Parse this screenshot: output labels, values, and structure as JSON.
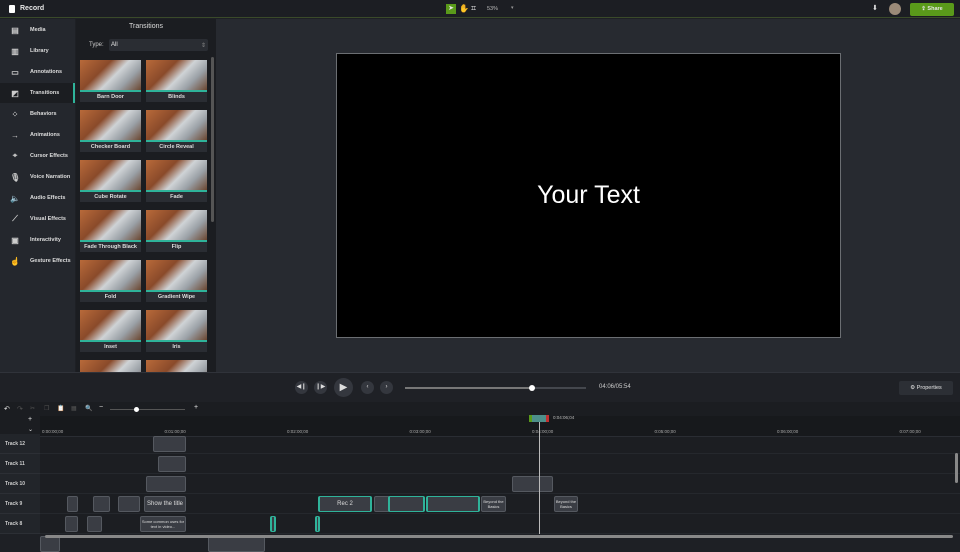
{
  "app": {
    "title": "Record",
    "zoom": "53%",
    "share_label": "Share",
    "accent": "#2fb39a",
    "share_color": "#5a9a1a"
  },
  "sidebar": {
    "items": [
      {
        "label": "Media",
        "icon": "film-icon"
      },
      {
        "label": "Library",
        "icon": "library-icon"
      },
      {
        "label": "Annotations",
        "icon": "annotation-icon"
      },
      {
        "label": "Transitions",
        "icon": "transition-icon",
        "active": true
      },
      {
        "label": "Behaviors",
        "icon": "behaviors-icon"
      },
      {
        "label": "Animations",
        "icon": "animation-icon"
      },
      {
        "label": "Cursor Effects",
        "icon": "cursor-icon"
      },
      {
        "label": "Voice Narration",
        "icon": "microphone-icon"
      },
      {
        "label": "Audio Effects",
        "icon": "speaker-icon"
      },
      {
        "label": "Visual Effects",
        "icon": "wand-icon"
      },
      {
        "label": "Interactivity",
        "icon": "interactivity-icon"
      },
      {
        "label": "Gesture Effects",
        "icon": "gesture-icon"
      }
    ]
  },
  "transitions": {
    "title": "Transitions",
    "type_label": "Type:",
    "type_value": "All",
    "items": [
      "Barn Door",
      "Blinds",
      "Checker Board",
      "Circle Reveal",
      "Cube Rotate",
      "Fade",
      "Fade Through Black",
      "Flip",
      "Fold",
      "Gradient Wipe",
      "Inset",
      "Iris",
      "",
      ""
    ]
  },
  "canvas": {
    "text": "Your Text"
  },
  "playback": {
    "time": "04:06/05:54",
    "progress": 0.7,
    "properties_label": "Properties"
  },
  "timeline": {
    "playhead": "0:04:06;04",
    "ticks": [
      "0:00:00;00",
      "0:01:00;00",
      "0:02:00;00",
      "0:03:00;00",
      "0:04:00;00",
      "0:05:00;00",
      "0:06:00;00",
      "0:07:00;00"
    ],
    "tracks": [
      "Track 12",
      "Track 11",
      "Track 10",
      "Track 9",
      "Track 8"
    ],
    "clips": {
      "show_title": "Show the title",
      "rec2": "Rec 2",
      "common_uses": "Some common uses for text in video...",
      "beyond1": "Beyond the Basics",
      "beyond2": "Beyond the Basics"
    }
  }
}
